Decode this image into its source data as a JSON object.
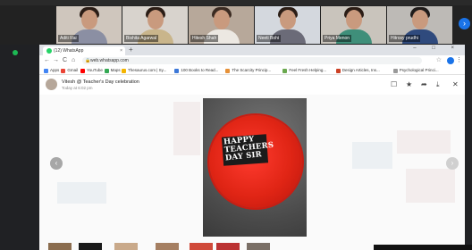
{
  "meeting": {
    "participants": [
      {
        "name": "Aditi Rai"
      },
      {
        "name": "Bishita Agarwal"
      },
      {
        "name": "Hitesh Shah"
      },
      {
        "name": "Neeti Bohi"
      },
      {
        "name": "Priya Menon"
      },
      {
        "name": "Hitrosy prudhi"
      }
    ],
    "next_icon": "chevron-right-icon",
    "next_glyph": "›"
  },
  "browser": {
    "tab_title": "(12) WhatsApp",
    "tab_close": "×",
    "new_tab": "+",
    "window_controls": "– □ ×",
    "url": "web.whatsapp.com",
    "nav": {
      "back": "←",
      "forward": "→",
      "reload": "C",
      "home": "⌂"
    },
    "star_glyph": "☆",
    "menu_glyph": "⋮",
    "bookmarks": [
      {
        "label": "Apps",
        "color": "#4285f4"
      },
      {
        "label": "Gmail",
        "color": "#ea4335"
      },
      {
        "label": "YouTube",
        "color": "#ff0000"
      },
      {
        "label": "Maps",
        "color": "#34a853"
      },
      {
        "label": "Thesaurus.com | Sy...",
        "color": "#f4b400"
      },
      {
        "label": "100 Books to Read...",
        "color": "#3c78d8"
      },
      {
        "label": "The Scarcity Princip...",
        "color": "#e69138"
      },
      {
        "label": "Feel Fresh Helping...",
        "color": "#6aa84f"
      },
      {
        "label": "Design Articles, Ins...",
        "color": "#cc4125"
      },
      {
        "label": "Psychological Princi...",
        "color": "#999999"
      }
    ]
  },
  "viewer": {
    "sender": "Vitesh @ Teacher's Day celebration",
    "time": "Today at 6:02 pm",
    "actions": [
      {
        "name": "caption-icon",
        "glyph": "☐"
      },
      {
        "name": "star-icon",
        "glyph": "★"
      },
      {
        "name": "forward-icon",
        "glyph": "➦"
      },
      {
        "name": "download-icon",
        "glyph": "⤓"
      },
      {
        "name": "close-icon",
        "glyph": "✕"
      }
    ],
    "plaque_lines": [
      "HAPPY",
      "TEACHERS",
      "DAY SIR"
    ],
    "prev_glyph": "‹",
    "next_glyph": "›"
  },
  "colors": {
    "whatsapp_green": "#25d366",
    "cake_red": "#e02515",
    "meet_blue": "#1a73e8"
  }
}
